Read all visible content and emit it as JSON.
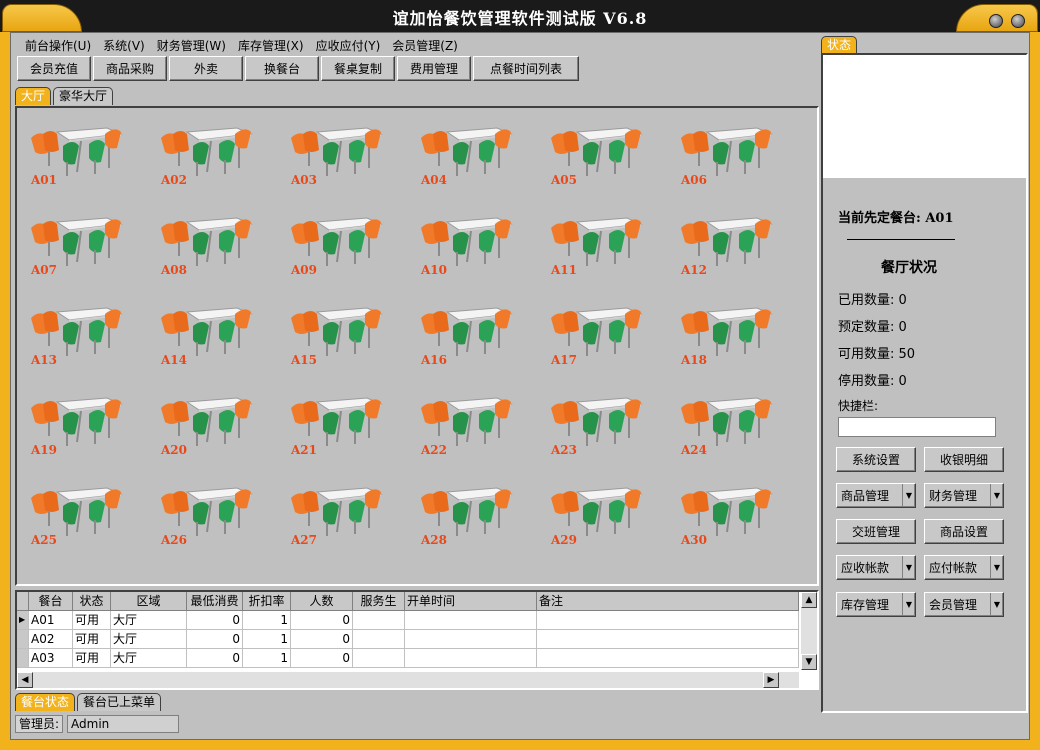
{
  "window": {
    "title": "谊加怡餐饮管理软件测试版 V6.8"
  },
  "menu": [
    "前台操作(U)",
    "系统(V)",
    "财务管理(W)",
    "库存管理(X)",
    "应收应付(Y)",
    "会员管理(Z)"
  ],
  "toolbar": [
    "会员充值",
    "商品采购",
    "外卖",
    "换餐台",
    "餐桌复制",
    "费用管理",
    "点餐时间列表"
  ],
  "area_tabs": [
    "大厅",
    "豪华大厅"
  ],
  "tables": [
    "A01",
    "A02",
    "A03",
    "A04",
    "A05",
    "A06",
    "A07",
    "A08",
    "A09",
    "A10",
    "A11",
    "A12",
    "A13",
    "A14",
    "A15",
    "A16",
    "A17",
    "A18",
    "A19",
    "A20",
    "A21",
    "A22",
    "A23",
    "A24",
    "A25",
    "A26",
    "A27",
    "A28",
    "A29",
    "A30"
  ],
  "grid": {
    "columns": [
      "餐台",
      "状态",
      "区域",
      "最低消费",
      "折扣率",
      "人数",
      "服务生",
      "开单时间",
      "备注"
    ],
    "rows": [
      [
        "A01",
        "可用",
        "大厅",
        "0",
        "1",
        "0",
        "",
        "",
        ""
      ],
      [
        "A02",
        "可用",
        "大厅",
        "0",
        "1",
        "0",
        "",
        "",
        ""
      ],
      [
        "A03",
        "可用",
        "大厅",
        "0",
        "1",
        "0",
        "",
        "",
        ""
      ]
    ]
  },
  "bottom_tabs": [
    "餐台状态",
    "餐台已上菜单"
  ],
  "status": {
    "admin_label": "管理员:",
    "admin_value": "Admin"
  },
  "right_panel": {
    "tab": "状态",
    "current_table": "当前先定餐台: A01",
    "section_title": "餐厅状况",
    "used": "已用数量: 0",
    "reserved": "预定数量: 0",
    "available": "可用数量: 50",
    "disabled": "停用数量: 0",
    "quick_label": "快捷栏:",
    "buttons": [
      "系统设置",
      "收银明细",
      "商品管理",
      "财务管理",
      "交班管理",
      "商品设置",
      "应收帐款",
      "应付帐款",
      "库存管理",
      "会员管理"
    ]
  },
  "colors": {
    "accent": "#f2b21c",
    "table_label": "#e8491b",
    "frame": "#c0c0c0"
  },
  "icons": {
    "table": "restaurant-table-icon"
  }
}
